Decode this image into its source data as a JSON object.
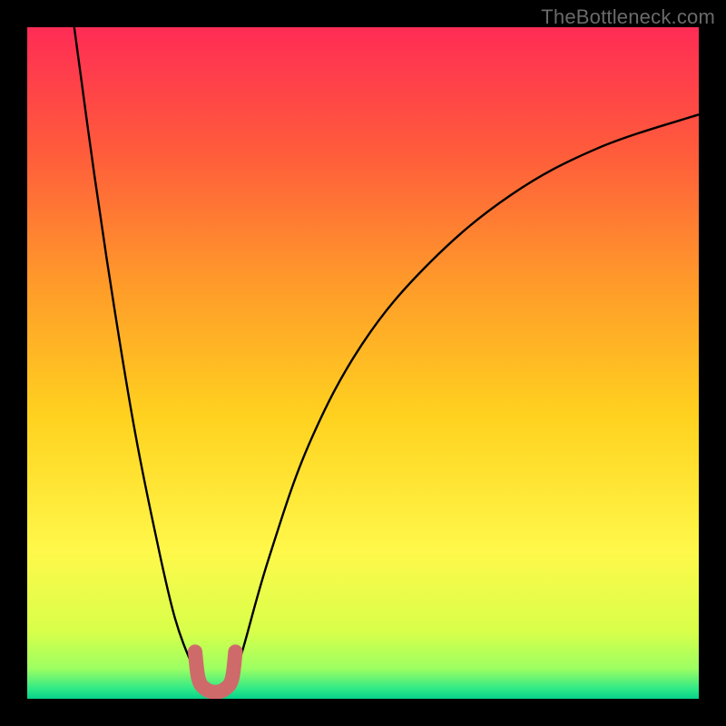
{
  "watermark": "TheBottleneck.com",
  "chart_data": {
    "type": "line",
    "title": "",
    "xlabel": "",
    "ylabel": "",
    "xlim": [
      0,
      100
    ],
    "ylim": [
      0,
      100
    ],
    "series": [
      {
        "name": "bottleneck-curve-left",
        "x": [
          7,
          10,
          13,
          16,
          19,
          22,
          25,
          26.5
        ],
        "y": [
          100,
          78,
          58,
          40,
          25,
          12,
          4,
          1
        ]
      },
      {
        "name": "bottleneck-curve-right",
        "x": [
          30,
          32,
          36,
          42,
          50,
          60,
          72,
          85,
          100
        ],
        "y": [
          1,
          7,
          21,
          38,
          53,
          65,
          75,
          82,
          87
        ]
      },
      {
        "name": "trough-marker",
        "x": [
          25,
          25.5,
          26.5,
          28,
          29.5,
          30.5,
          31
        ],
        "y": [
          7,
          3,
          1.5,
          1,
          1.5,
          3,
          7
        ]
      }
    ],
    "background_gradient": {
      "stops": [
        {
          "offset": 0.0,
          "color": "#ff2c55"
        },
        {
          "offset": 0.18,
          "color": "#ff5a3c"
        },
        {
          "offset": 0.38,
          "color": "#ff9a2a"
        },
        {
          "offset": 0.58,
          "color": "#ffd21f"
        },
        {
          "offset": 0.78,
          "color": "#fff84a"
        },
        {
          "offset": 0.9,
          "color": "#d8ff4a"
        },
        {
          "offset": 0.955,
          "color": "#9dff62"
        },
        {
          "offset": 0.985,
          "color": "#30e987"
        },
        {
          "offset": 1.0,
          "color": "#06d18a"
        }
      ]
    },
    "trough_marker_color": "#cf6a6a",
    "curve_color": "#000000"
  }
}
